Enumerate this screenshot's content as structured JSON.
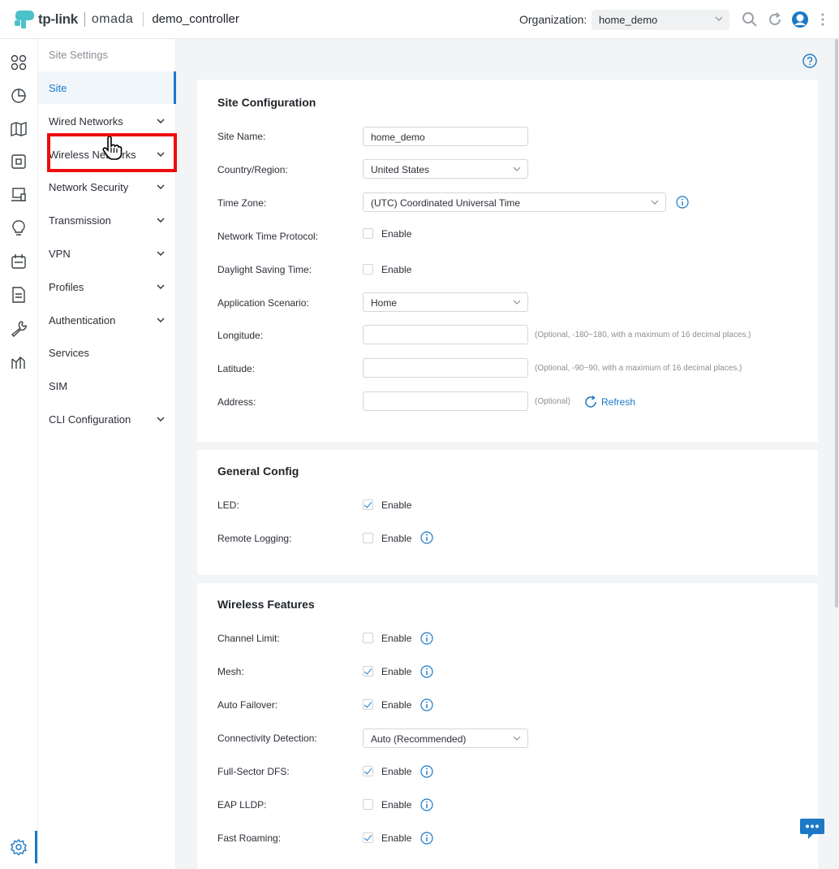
{
  "header": {
    "brand": "tp-link",
    "product": "omada",
    "controller": "demo_controller",
    "org_label": "Organization:",
    "org_value": "home_demo"
  },
  "rail": {
    "icons": [
      "dashboard-icon",
      "statistics-icon",
      "map-icon",
      "devices-icon",
      "clients-icon",
      "insights-icon",
      "logs-icon",
      "reports-icon",
      "tools-icon",
      "analytics-icon",
      "settings-icon"
    ]
  },
  "sidebar": {
    "title": "Site Settings",
    "items": [
      {
        "label": "Site",
        "active": true,
        "expandable": false
      },
      {
        "label": "Wired Networks",
        "expandable": true
      },
      {
        "label": "Wireless Networks",
        "expandable": true
      },
      {
        "label": "Network Security",
        "expandable": true
      },
      {
        "label": "Transmission",
        "expandable": true
      },
      {
        "label": "VPN",
        "expandable": true
      },
      {
        "label": "Profiles",
        "expandable": true
      },
      {
        "label": "Authentication",
        "expandable": true
      },
      {
        "label": "Services",
        "expandable": false
      },
      {
        "label": "SIM",
        "expandable": false
      },
      {
        "label": "CLI Configuration",
        "expandable": true
      }
    ]
  },
  "site_config": {
    "title": "Site Configuration",
    "site_name_label": "Site Name",
    "site_name_value": "home_demo",
    "country_label": "Country/Region",
    "country_value": "United States",
    "timezone_label": "Time Zone",
    "timezone_value": "(UTC) Coordinated Universal Time",
    "ntp_label": "Network Time Protocol",
    "dst_label": "Daylight Saving Time",
    "scenario_label": "Application Scenario",
    "scenario_value": "Home",
    "longitude_label": "Longitude",
    "longitude_hint": "(Optional, -180~180, with a maximum of 16 decimal places.)",
    "latitude_label": "Latitude",
    "latitude_hint": "(Optional, -90~90, with a maximum of 16 decimal places.)",
    "address_label": "Address",
    "address_hint": "(Optional)",
    "refresh_label": "Refresh",
    "enable": "Enable"
  },
  "general_config": {
    "title": "General Config",
    "led_label": "LED",
    "remote_logging_label": "Remote Logging",
    "enable": "Enable"
  },
  "wireless_features": {
    "title": "Wireless Features",
    "channel_limit_label": "Channel Limit",
    "mesh_label": "Mesh",
    "auto_failover_label": "Auto Failover",
    "connectivity_label": "Connectivity Detection",
    "connectivity_value": "Auto (Recommended)",
    "full_sector_label": "Full-Sector DFS",
    "eap_lldp_label": "EAP LLDP",
    "fast_roaming_label": "Fast Roaming",
    "enable": "Enable"
  },
  "checkbox_state": {
    "ntp": false,
    "dst": false,
    "led": true,
    "remote_logging": false,
    "channel_limit": false,
    "mesh": true,
    "auto_failover": true,
    "full_sector_dfs": true,
    "eap_lldp": false,
    "fast_roaming": true
  },
  "colors": {
    "accent": "#1b79c6",
    "highlight": "#ee0d0d"
  }
}
